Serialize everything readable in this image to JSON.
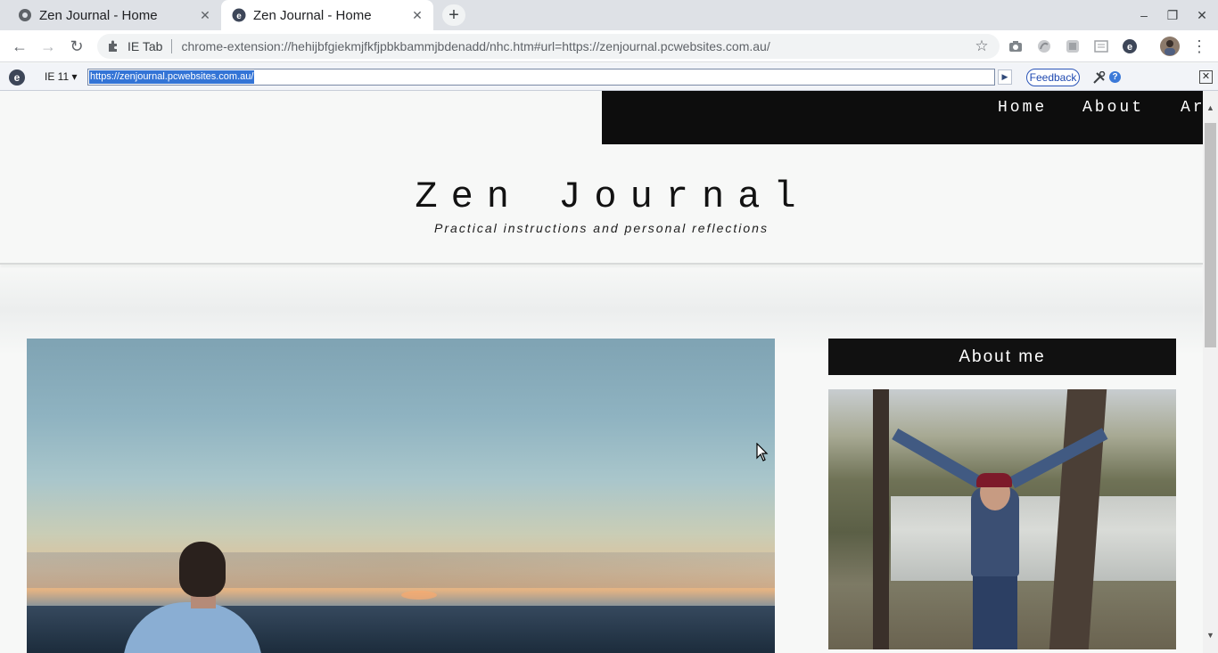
{
  "browser": {
    "tabs": [
      {
        "title": "Zen Journal - Home",
        "active": false,
        "favicon": "extension-puzzle-icon"
      },
      {
        "title": "Zen Journal - Home",
        "active": true,
        "favicon": "ie-tab-icon"
      }
    ],
    "new_tab_label": "+",
    "window_controls": {
      "minimize": "–",
      "maximize": "❐",
      "close": "✕"
    },
    "nav": {
      "back": "←",
      "forward": "→",
      "reload": "↻"
    },
    "omnibox": {
      "extension_label": "IE Tab",
      "url": "chrome-extension://hehijbfgiekmjfkfjpbkbammjbdenadd/nhc.htm#url=https://zenjournal.pcwebsites.com.au/"
    },
    "menu_label": "⋮"
  },
  "ietab": {
    "version": "IE 11 ▾",
    "address": "https://zenjournal.pcwebsites.com.au/",
    "go_label": "▶",
    "feedback_label": "Feedback",
    "help_label": "?",
    "close_label": "✕"
  },
  "site": {
    "nav": [
      {
        "label": "Home"
      },
      {
        "label": "About"
      },
      {
        "label": "Ar"
      }
    ],
    "title": "Zen Journal",
    "tagline": "Practical instructions and personal reflections",
    "sidebar": {
      "about_heading": "About me"
    }
  },
  "colors": {
    "nav_background": "#0d0d0d",
    "page_background": "#f7f8f7",
    "feedback_accent": "#1e48b0",
    "selection": "#3374d6"
  }
}
